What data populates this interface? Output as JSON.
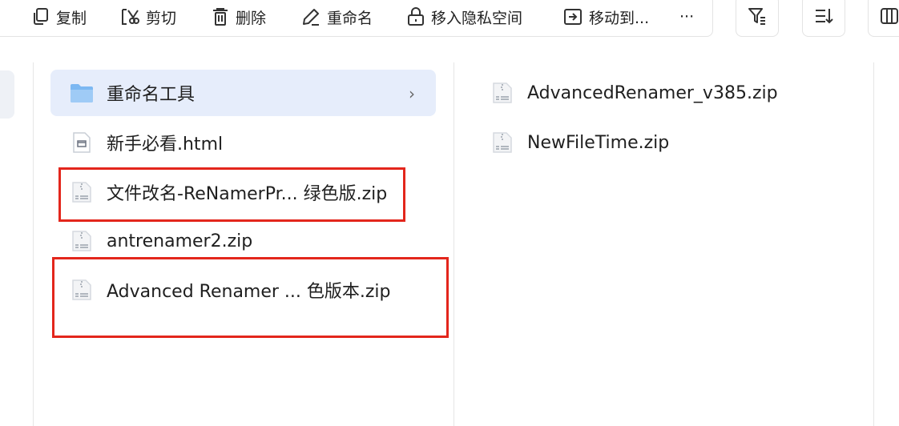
{
  "toolbar": {
    "edge_glyph": "≡",
    "copy": "复制",
    "cut": "剪切",
    "delete": "删除",
    "rename": "重命名",
    "private": "移入隐私空间",
    "move": "移动到...",
    "more": "···"
  },
  "middle_pane": {
    "items": [
      {
        "name": "重命名工具",
        "icon": "folder-icon",
        "selected": true
      },
      {
        "name": "新手必看.html",
        "icon": "html-file-icon"
      },
      {
        "name": "文件改名-ReNamerPr... 绿色版.zip",
        "icon": "zip-file-icon"
      },
      {
        "name": "antrenamer2.zip",
        "icon": "zip-file-icon"
      },
      {
        "name": "Advanced Renamer ...  色版本.zip",
        "icon": "zip-file-icon"
      }
    ]
  },
  "right_pane": {
    "items": [
      {
        "name": "AdvancedRenamer_v385.zip",
        "icon": "zip-file-icon"
      },
      {
        "name": "NewFileTime.zip",
        "icon": "zip-file-icon"
      }
    ]
  },
  "colors": {
    "highlight_box": "#e3261c",
    "selected_row": "#e6edfb",
    "folder": "#7cb8f2"
  }
}
